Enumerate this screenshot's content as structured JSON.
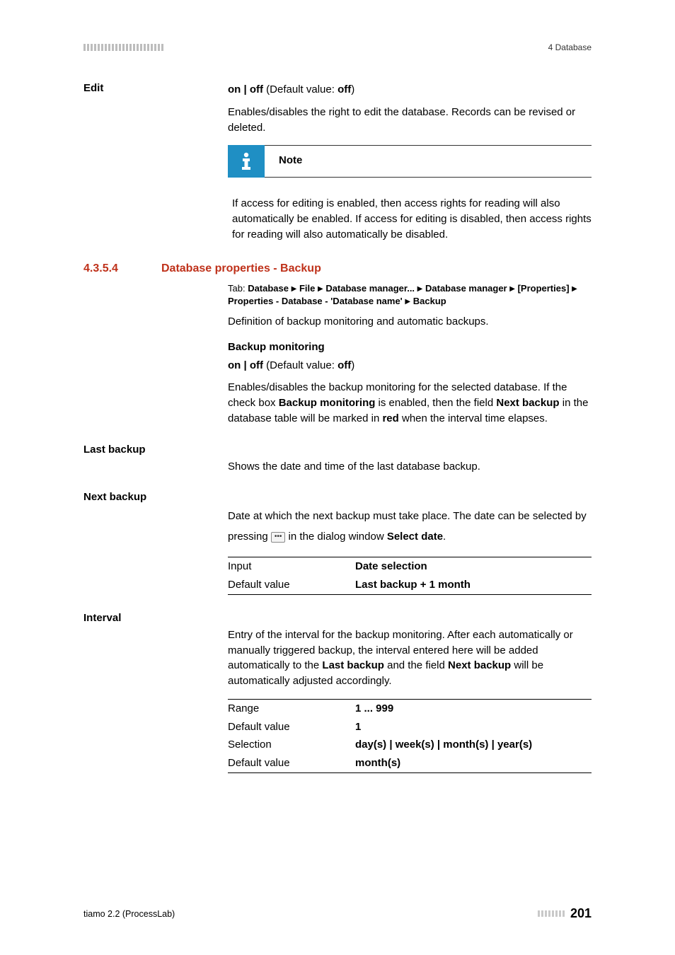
{
  "header": {
    "right": "4 Database"
  },
  "edit": {
    "label": "Edit",
    "onoff_prefix": "on | off",
    "onoff_default_label": " (Default value: ",
    "onoff_default_value": "off",
    "onoff_suffix": ")",
    "desc": "Enables/disables the right to edit the database. Records can be revised or deleted."
  },
  "note": {
    "label": "Note",
    "body": "If access for editing is enabled, then access rights for reading will also automatically be enabled. If access for editing is disabled, then access rights for reading will also automatically be disabled."
  },
  "section": {
    "num": "4.3.5.4",
    "title": "Database properties - Backup",
    "tab_prefix": "Tab: ",
    "tab_parts": [
      "Database",
      "File",
      "Database manager...",
      "Database manager",
      "[Properties]",
      "Properties - Database - 'Database name'",
      "Backup"
    ],
    "definition": "Definition of backup monitoring and automatic backups."
  },
  "backup_monitoring": {
    "heading": "Backup monitoring",
    "onoff_prefix": "on | off",
    "onoff_default_label": " (Default value: ",
    "onoff_default_value": "off",
    "onoff_suffix": ")",
    "desc_pre": "Enables/disables the backup monitoring for the selected database. If the check box ",
    "desc_b1": "Backup monitoring",
    "desc_mid": " is enabled, then the field ",
    "desc_b2": "Next backup",
    "desc_mid2": " in the database table will be marked in ",
    "desc_b3": "red",
    "desc_post": " when the interval time elapses."
  },
  "last_backup": {
    "label": "Last backup",
    "desc": "Shows the date and time of the last database backup."
  },
  "next_backup": {
    "label": "Next backup",
    "desc_pre": "Date at which the next backup must take place. The date can be selected by pressing ",
    "desc_mid": " in the dialog window ",
    "desc_b": "Select date",
    "desc_post": ".",
    "input_label": "Input",
    "input_value": "Date selection",
    "default_label": "Default value",
    "default_value": "Last backup + 1 month"
  },
  "interval": {
    "label": "Interval",
    "desc_pre": "Entry of the interval for the backup monitoring. After each automatically or manually triggered backup, the interval entered here will be added automatically to the ",
    "desc_b1": "Last backup",
    "desc_mid": " and the field ",
    "desc_b2": "Next backup",
    "desc_post": " will be automatically adjusted accordingly.",
    "range_label": "Range",
    "range_value": "1 ... 999",
    "default1_label": "Default value",
    "default1_value": "1",
    "selection_label": "Selection",
    "selection_value": "day(s) | week(s) | month(s) | year(s)",
    "default2_label": "Default value",
    "default2_value": "month(s)"
  },
  "footer": {
    "left": "tiamo 2.2 (ProcessLab)",
    "page": "201"
  }
}
